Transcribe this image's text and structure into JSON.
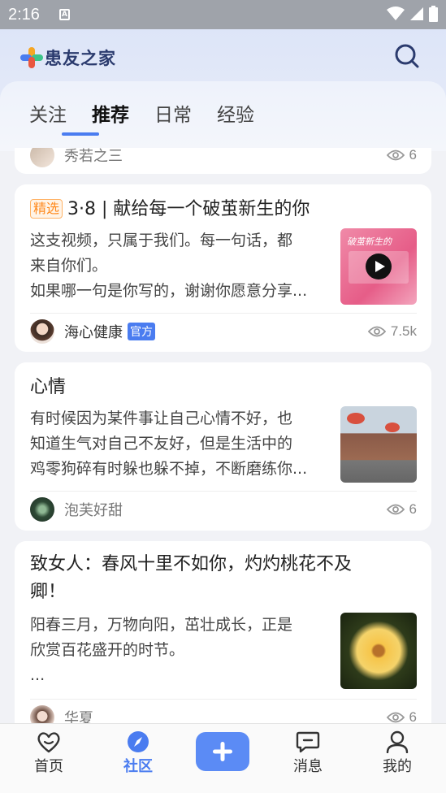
{
  "status_bar": {
    "time": "2:16",
    "sim_label": "A"
  },
  "app": {
    "logo_text": "患友之家"
  },
  "tabs": [
    {
      "label": "关注"
    },
    {
      "label": "推荐"
    },
    {
      "label": "日常"
    },
    {
      "label": "经验"
    }
  ],
  "active_tab": "推荐",
  "partial_card": {
    "author": "秀若之三",
    "views": "6"
  },
  "cards": [
    {
      "badge": "精选",
      "title": "3·8 | 献给每一个破茧新生的你",
      "excerpt": [
        "这支视频，只属于我们。每一句话，都",
        "来自你们。",
        "如果哪一句是你写的，谢谢你愿意分享..."
      ],
      "thumb_text": "破茧新生的",
      "author": "海心健康",
      "official": "官方",
      "views": "7.5k"
    },
    {
      "title": "心情",
      "excerpt": [
        "有时候因为某件事让自己心情不好，也",
        "知道生气对自己不友好，但是生活中的",
        "鸡零狗碎有时躲也躲不掉，不断磨练你..."
      ],
      "author": "泡芙好甜",
      "views": "6"
    },
    {
      "title_lines": [
        "致女人：春风十里不如你，灼灼桃花不及",
        "卿！"
      ],
      "excerpt": [
        "阳春三月，万物向阳，茁壮成长，正是",
        "欣赏百花盛开的时节。",
        "..."
      ],
      "author": "华夏",
      "views": "6"
    }
  ],
  "bottom_nav": [
    {
      "label": "首页",
      "icon": "heart-icon"
    },
    {
      "label": "社区",
      "icon": "compass-icon"
    },
    {
      "label": "",
      "icon": "plus-icon"
    },
    {
      "label": "消息",
      "icon": "message-icon"
    },
    {
      "label": "我的",
      "icon": "user-icon"
    }
  ],
  "colors": {
    "accent": "#4a7cf0",
    "badge": "#ff8a1e"
  }
}
